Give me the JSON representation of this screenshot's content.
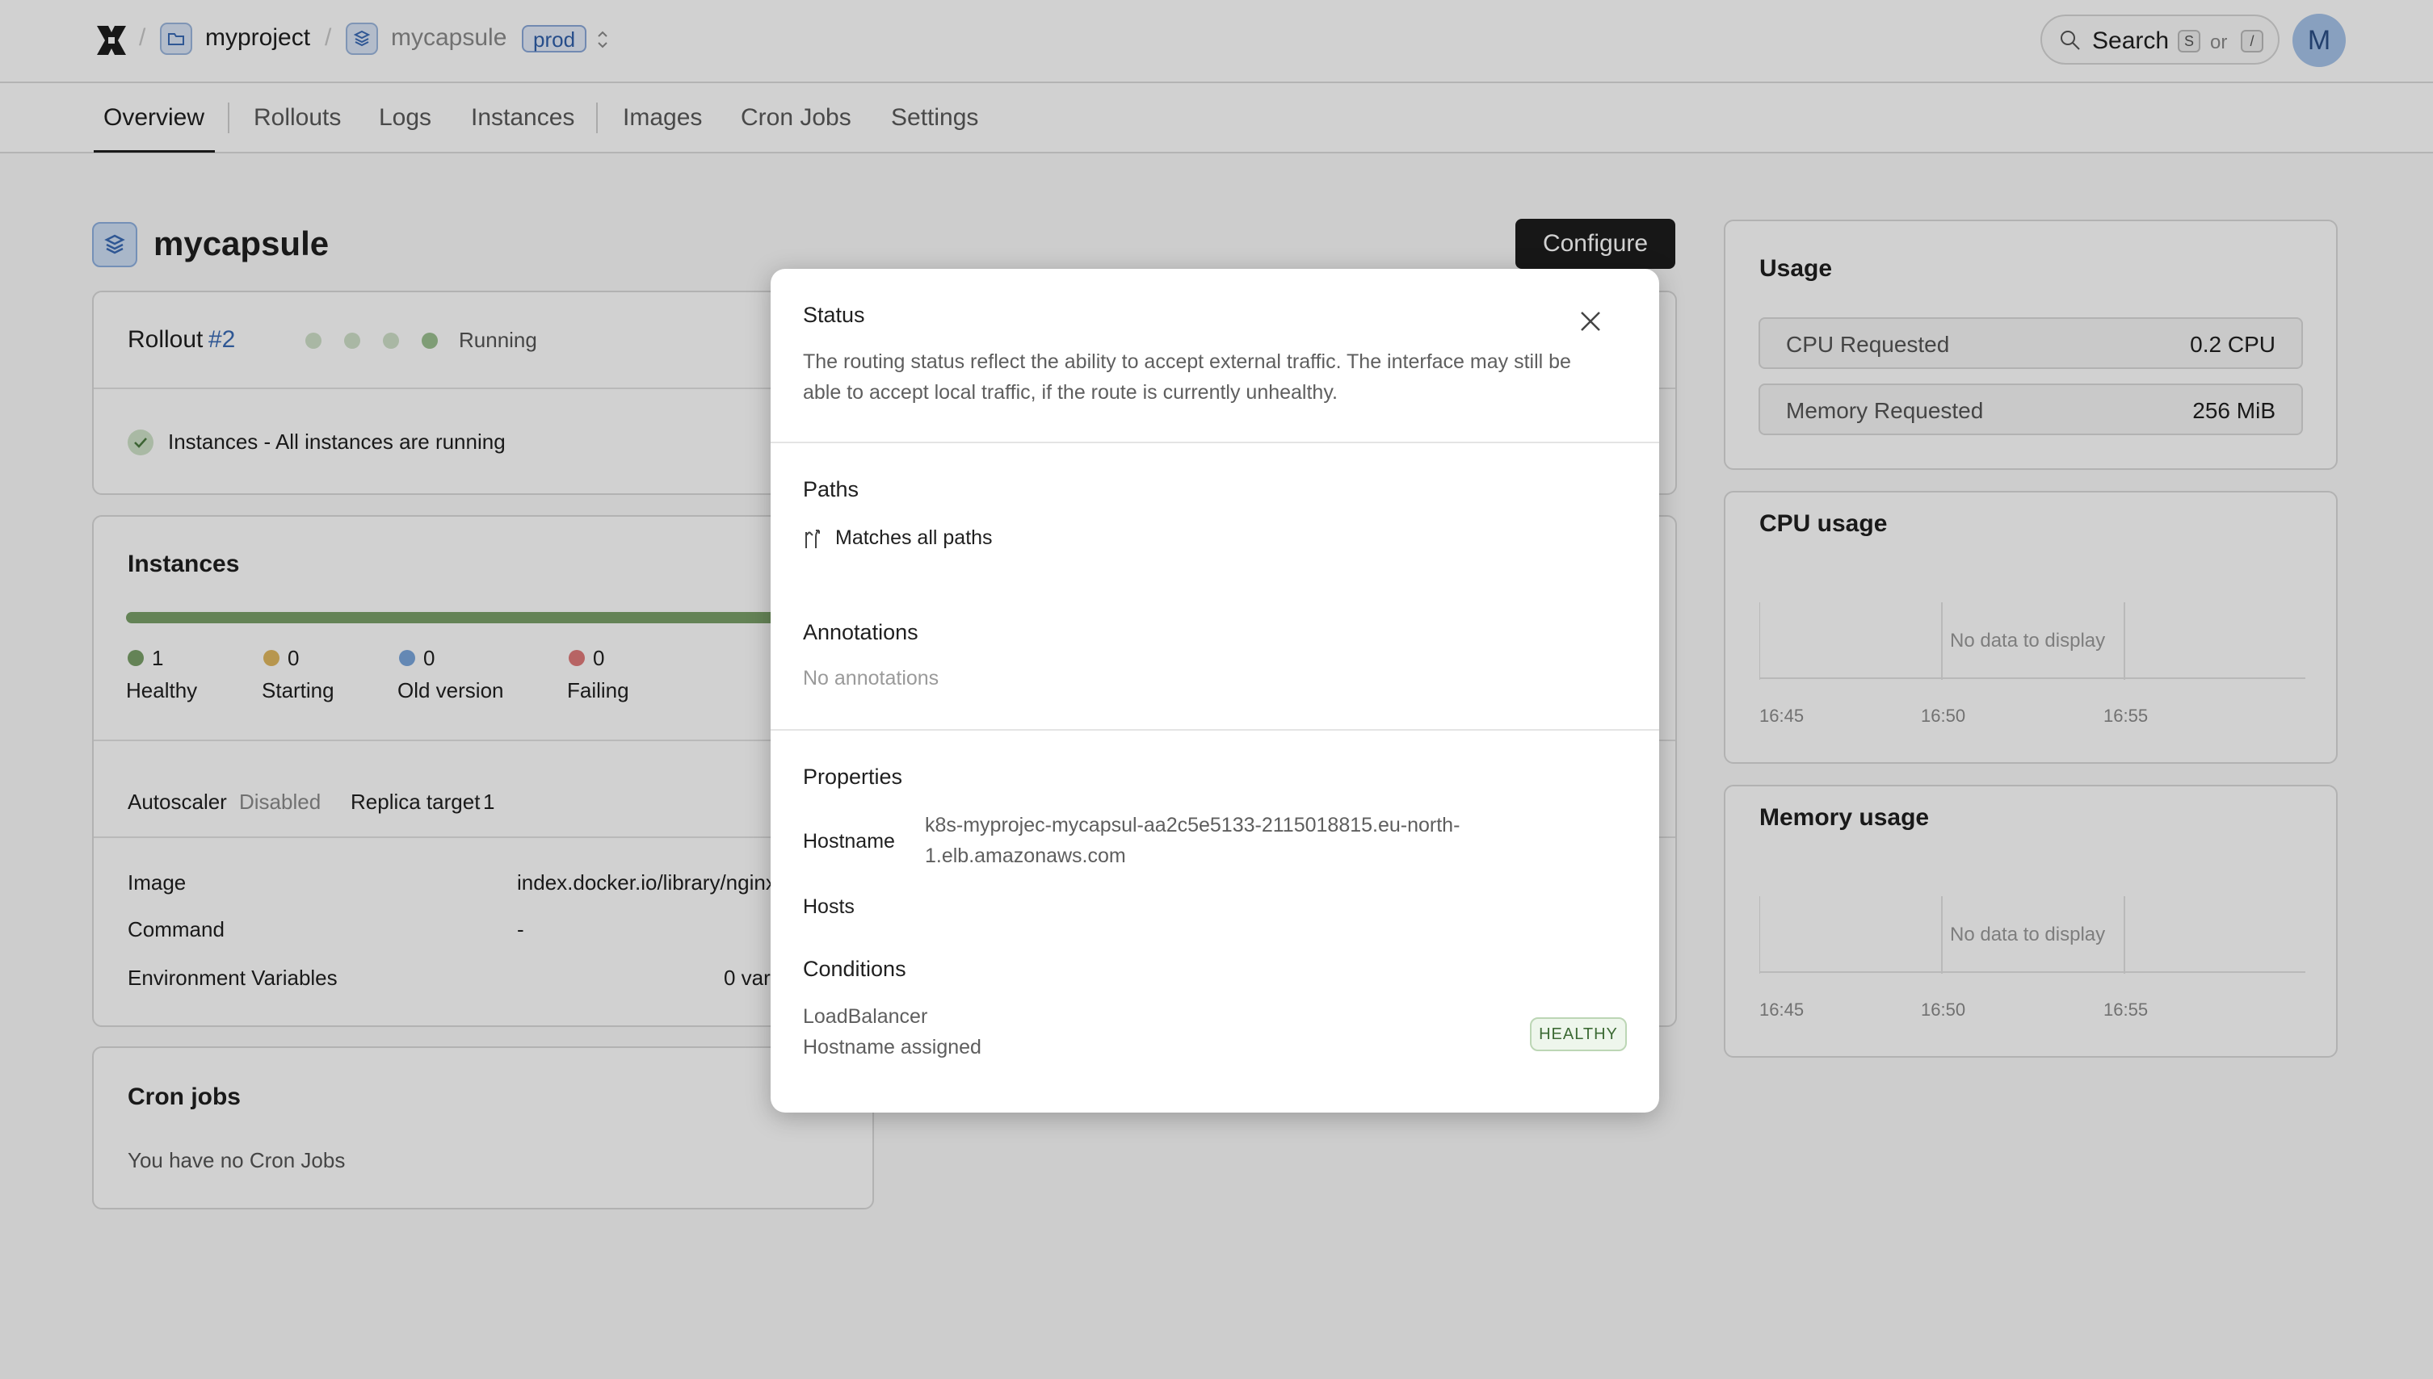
{
  "header": {
    "project": "myproject",
    "capsule": "mycapsule",
    "environment": "prod",
    "search_label": "Search",
    "search_key_1": "S",
    "search_or": "or",
    "search_key_2": "/",
    "avatar_initial": "M"
  },
  "tabs": [
    "Overview",
    "Rollouts",
    "Logs",
    "Instances",
    "Images",
    "Cron Jobs",
    "Settings"
  ],
  "main": {
    "title": "mycapsule",
    "configure_label": "Configure",
    "rollout": {
      "label": "Rollout",
      "number": "#2",
      "status": "Running"
    },
    "instances_msg": "Instances - All instances are running",
    "instances": {
      "title": "Instances",
      "counts": [
        {
          "value": "1",
          "label": "Healthy",
          "color": "#7aa06a"
        },
        {
          "value": "0",
          "label": "Starting",
          "color": "#e0b860"
        },
        {
          "value": "0",
          "label": "Old version",
          "color": "#7aa6dc"
        },
        {
          "value": "0",
          "label": "Failing",
          "color": "#e07a7a"
        }
      ],
      "autoscaler_label": "Autoscaler",
      "autoscaler_value": "Disabled",
      "replica_label": "Replica target",
      "replica_value": "1",
      "image_label": "Image",
      "image_value": "index.docker.io/library/nginx",
      "command_label": "Command",
      "command_value": "-",
      "env_label": "Environment Variables",
      "env_value": "0 var"
    },
    "cron": {
      "title": "Cron jobs",
      "empty": "You have no Cron Jobs"
    }
  },
  "usage": {
    "title": "Usage",
    "cpu_label": "CPU Requested",
    "cpu_value": "0.2 CPU",
    "mem_label": "Memory Requested",
    "mem_value": "256 MiB"
  },
  "cpu_chart": {
    "title": "CPU usage",
    "nodata": "No data to display",
    "ticks": [
      "16:45",
      "16:50",
      "16:55"
    ]
  },
  "mem_chart": {
    "title": "Memory usage",
    "nodata": "No data to display",
    "ticks": [
      "16:45",
      "16:50",
      "16:55"
    ]
  },
  "modal": {
    "status_title": "Status",
    "status_text_1": "The routing status reflect the ability to accept external traffic. The interface may still be",
    "status_text_2": "able to accept local traffic, if the route is currently unhealthy.",
    "paths_title": "Paths",
    "paths_value": "Matches all paths",
    "annotations_title": "Annotations",
    "annotations_value": "No annotations",
    "properties_title": "Properties",
    "hostname_label": "Hostname",
    "hostname_value_1": "k8s-myprojec-mycapsul-aa2c5e5133-2115018815.eu-north-",
    "hostname_value_2": "1.elb.amazonaws.com",
    "hosts_label": "Hosts",
    "conditions_title": "Conditions",
    "condition_type": "LoadBalancer",
    "condition_reason": "Hostname assigned",
    "condition_badge": "HEALTHY"
  }
}
